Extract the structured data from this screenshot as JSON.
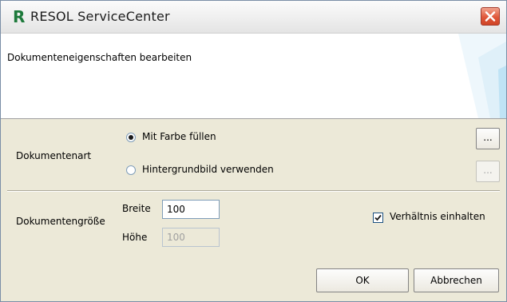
{
  "window": {
    "logo_letter": "R",
    "title": "RESOL ServiceCenter"
  },
  "header": {
    "title": "Dokumenteneigenschaften bearbeiten"
  },
  "document_type": {
    "label": "Dokumentenart",
    "options": [
      {
        "label": "Mit Farbe füllen",
        "selected": true
      },
      {
        "label": "Hintergrundbild verwenden",
        "selected": false
      }
    ],
    "browse_buttons": [
      {
        "label": "...",
        "enabled": true
      },
      {
        "label": "...",
        "enabled": false
      }
    ]
  },
  "document_size": {
    "label": "Dokumentengröße",
    "width_label": "Breite",
    "width_value": "100",
    "height_label": "Höhe",
    "height_value": "100",
    "keep_ratio_label": "Verhältnis einhalten",
    "keep_ratio_checked": true
  },
  "buttons": {
    "ok": "OK",
    "cancel": "Abbrechen"
  },
  "colors": {
    "logo_green": "#1e7a3c",
    "dialog_background": "#ece9d8",
    "close_button": "#e0573a",
    "header_accent": "#a8d8f0"
  },
  "icons": {
    "close": "close-icon",
    "checkmark": "checkmark-icon"
  }
}
